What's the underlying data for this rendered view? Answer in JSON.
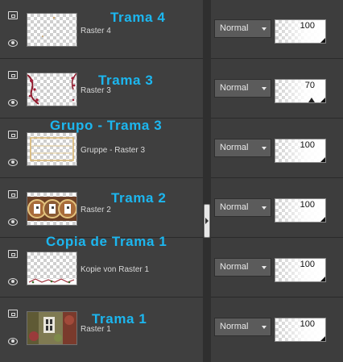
{
  "layers": [
    {
      "name": "Raster 4",
      "annotation": "Trama 4",
      "blend_mode": "Normal",
      "opacity": 100
    },
    {
      "name": "Raster 3",
      "annotation": "Trama 3",
      "blend_mode": "Normal",
      "opacity": 70
    },
    {
      "name": "Gruppe - Raster 3",
      "annotation": "Grupo - Trama 3",
      "blend_mode": "Normal",
      "opacity": 100
    },
    {
      "name": "Raster 2",
      "annotation": "Trama 2",
      "blend_mode": "Normal",
      "opacity": 100
    },
    {
      "name": "Kopie von Raster 1",
      "annotation": "Copia de Trama 1",
      "blend_mode": "Normal",
      "opacity": 100
    },
    {
      "name": "Raster 1",
      "annotation": "Trama 1",
      "blend_mode": "Normal",
      "opacity": 100
    }
  ],
  "icons": {
    "group": "layer-group-icon",
    "visibility": "eye-icon",
    "dropdown": "chevron-down-icon"
  },
  "colors": {
    "annotation": "#1cb7f0",
    "panel": "#3f3f3f",
    "control": "#5b5b5b"
  }
}
